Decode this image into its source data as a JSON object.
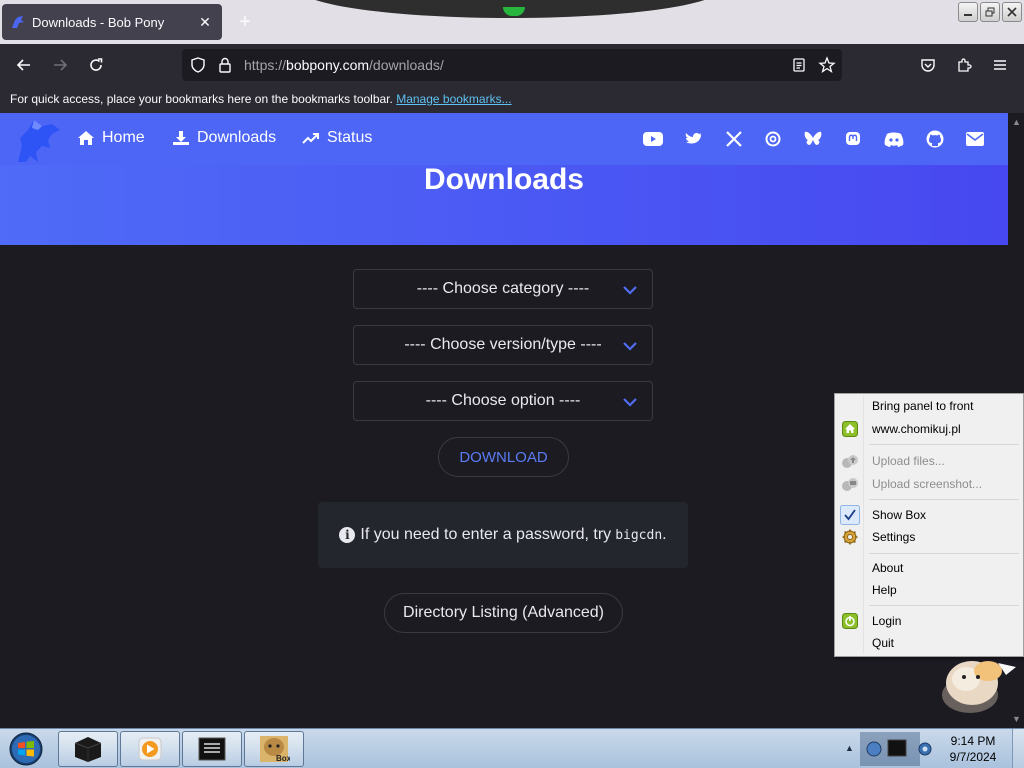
{
  "browser": {
    "tab_title": "Downloads - Bob Pony",
    "url_prefix": "https://",
    "url_domain": "bobpony.com",
    "url_path": "/downloads/",
    "bookmarks_text": "For quick access, place your bookmarks here on the bookmarks toolbar.",
    "bookmarks_link": "Manage bookmarks..."
  },
  "site": {
    "nav": [
      {
        "label": "Home",
        "icon": "home-icon"
      },
      {
        "label": "Downloads",
        "icon": "download-icon"
      },
      {
        "label": "Status",
        "icon": "trending-icon"
      }
    ],
    "social_icons": [
      "youtube-icon",
      "twitter-icon",
      "x-icon",
      "threads-icon",
      "bluesky-icon",
      "mastodon-icon",
      "discord-icon",
      "github-icon",
      "email-icon"
    ],
    "page_title": "Downloads",
    "selects": {
      "category": "---- Choose category ----",
      "version": "---- Choose version/type ----",
      "option": "---- Choose option ----"
    },
    "download_label": "DOWNLOAD",
    "notice_text": "If you need to enter a password, try",
    "notice_code": "bigcdn",
    "notice_end": ".",
    "directory_label": "Directory Listing (Advanced)"
  },
  "context_menu": {
    "items": [
      {
        "label": "Bring panel to front",
        "icon": "",
        "disabled": false
      },
      {
        "label": "www.chomikuj.pl",
        "icon": "home-icon",
        "disabled": false
      },
      {
        "label": "Upload files...",
        "icon": "upload-icon",
        "disabled": true
      },
      {
        "label": "Upload screenshot...",
        "icon": "screenshot-icon",
        "disabled": true
      },
      {
        "label": "Show Box",
        "icon": "check-icon",
        "disabled": false
      },
      {
        "label": "Settings",
        "icon": "gear-icon",
        "disabled": false
      },
      {
        "label": "About",
        "icon": "",
        "disabled": false
      },
      {
        "label": "Help",
        "icon": "",
        "disabled": false
      },
      {
        "label": "Login",
        "icon": "power-icon",
        "disabled": false
      },
      {
        "label": "Quit",
        "icon": "",
        "disabled": false
      }
    ]
  },
  "taskbar": {
    "time": "9:14 PM",
    "date": "9/7/2024",
    "pinned": [
      "terminal-icon",
      "media-player-icon",
      "console-icon",
      "chomikbox-icon"
    ]
  },
  "colors": {
    "accent_blue": "#4d66f6",
    "page_bg": "#1c1b22",
    "chrome_bg": "#2b2a33",
    "link": "#5fc1f0"
  }
}
